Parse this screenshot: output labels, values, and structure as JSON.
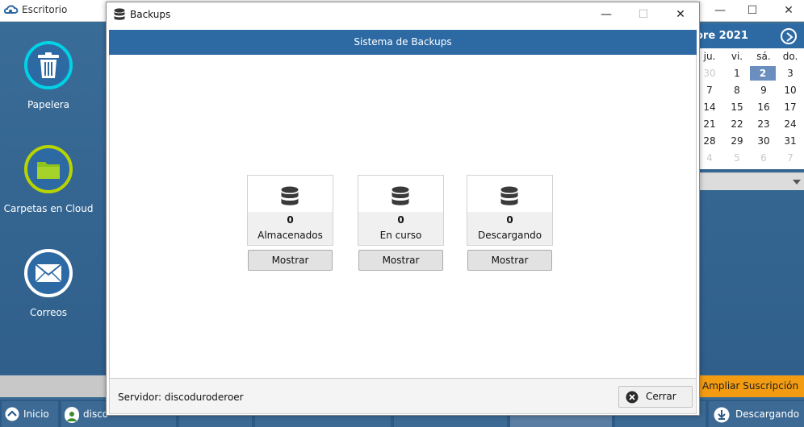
{
  "background": {
    "title": "Escritorio",
    "controls": {
      "minimize": "—",
      "maximize": "☐",
      "close": "✕"
    },
    "desktop_icons": [
      {
        "label": "Papelera",
        "icon": "trash-icon",
        "ring": "#00d2e6"
      },
      {
        "label": "Carpetas en Cloud",
        "icon": "folder-icon",
        "ring": "#b8d400"
      },
      {
        "label": "Correos",
        "icon": "mail-icon",
        "ring": "#ffffff"
      }
    ],
    "calendar": {
      "month_label": "ore 2021",
      "weekdays": [
        "ju.",
        "vi.",
        "sá.",
        "do."
      ],
      "weeks": [
        [
          {
            "d": "30",
            "muted": true
          },
          {
            "d": "1"
          },
          {
            "d": "2",
            "sel": true
          },
          {
            "d": "3"
          }
        ],
        [
          {
            "d": "7"
          },
          {
            "d": "8"
          },
          {
            "d": "9"
          },
          {
            "d": "10"
          }
        ],
        [
          {
            "d": "14"
          },
          {
            "d": "15"
          },
          {
            "d": "16"
          },
          {
            "d": "17"
          }
        ],
        [
          {
            "d": "21"
          },
          {
            "d": "22"
          },
          {
            "d": "23"
          },
          {
            "d": "24"
          }
        ],
        [
          {
            "d": "28"
          },
          {
            "d": "29"
          },
          {
            "d": "30"
          },
          {
            "d": "31"
          }
        ],
        [
          {
            "d": "4",
            "muted": true
          },
          {
            "d": "5",
            "muted": true
          },
          {
            "d": "6",
            "muted": true
          },
          {
            "d": "7",
            "muted": true
          }
        ]
      ]
    },
    "upgrade_label": "Ampliar Suscripción",
    "taskbar": {
      "start_label": "Inicio",
      "user_label": "disco",
      "download_label": "Descargando"
    }
  },
  "modal": {
    "title": "Backups",
    "controls": {
      "minimize": "—",
      "maximize": "☐",
      "close": "✕"
    },
    "header": "Sistema de Backups",
    "cards": [
      {
        "count": "0",
        "label": "Almacenados",
        "button": "Mostrar"
      },
      {
        "count": "0",
        "label": "En curso",
        "button": "Mostrar"
      },
      {
        "count": "0",
        "label": "Descargando",
        "button": "Mostrar"
      }
    ],
    "server_text": "Servidor: discoduroderoer",
    "close_label": "Cerrar"
  },
  "colors": {
    "accent": "#2d6aa4",
    "desktop": "#3a6b95",
    "upgrade": "#f39c12"
  }
}
